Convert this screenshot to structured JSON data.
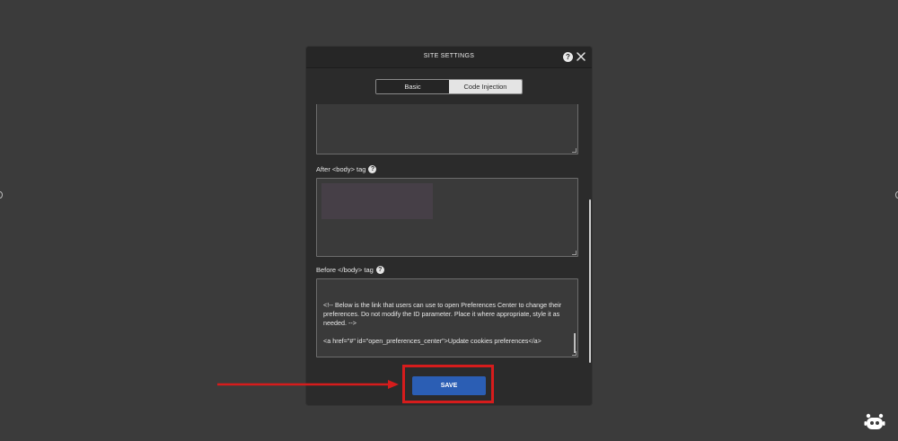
{
  "modal": {
    "title": "SITE SETTINGS",
    "help_icon": "question-icon",
    "close_icon": "close-icon",
    "tabs": [
      {
        "label": "Basic",
        "active": false
      },
      {
        "label": "Code Injection",
        "active": true
      }
    ],
    "fields": {
      "after_body": {
        "label": "After <body> tag",
        "value": ""
      },
      "before_body": {
        "label": "Before </body> tag",
        "value_lines": [
          "<!-- Below is the link that users can use to open Preferences Center to change their preferences. Do not modify the ID parameter. Place it where appropriate, style it as needed. -->",
          "<a href=\"#\" id=\"open_preferences_center\">Update cookies preferences</a>"
        ]
      }
    },
    "save_label": "SAVE"
  },
  "colors": {
    "background": "#3b3b3b",
    "modal": "#2b2b2b",
    "save_button": "#2b5eb4",
    "annotation": "#d61c1c"
  },
  "icons": {
    "annotation_arrow": "arrow-right-icon",
    "assistant": "bot-icon"
  }
}
